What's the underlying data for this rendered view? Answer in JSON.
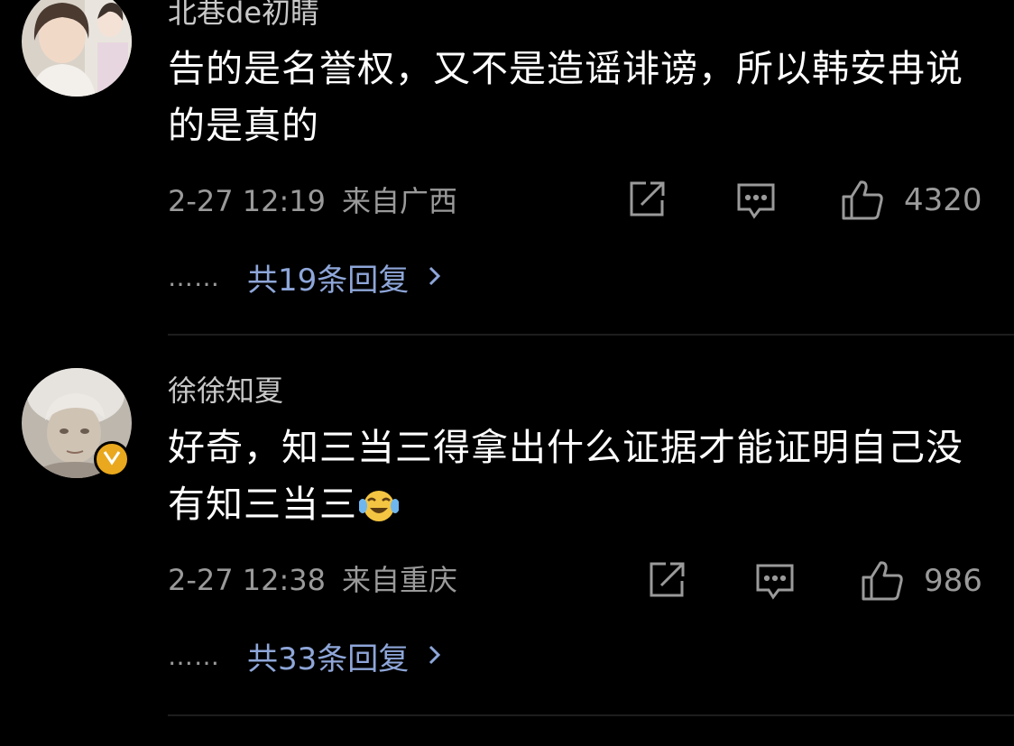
{
  "comments": [
    {
      "username": "北巷de初睛",
      "content": "告的是名誉权，又不是造谣诽谤，所以韩安冉说的是真的",
      "time": "2-27 12:19",
      "location": "来自广西",
      "likes": "4320",
      "replies": "共19条回复",
      "dots": "……",
      "verified": false
    },
    {
      "username": "徐徐知夏",
      "content": "好奇，知三当三得拿出什么证据才能证明自己没有知三当三",
      "time": "2-27 12:38",
      "location": "来自重庆",
      "likes": "986",
      "replies": "共33条回复",
      "dots": "……",
      "verified": true,
      "emoji": "laugh-cry-emoji"
    }
  ],
  "icons": {
    "share": "share-icon",
    "comment": "comment-icon",
    "like": "thumbs-up-icon",
    "chevron": "chevron-right-icon",
    "verified": "verified-v-icon"
  },
  "colors": {
    "background": "#000000",
    "text": "#ffffff",
    "muted": "#9a9a9a",
    "link": "#8ea6d9",
    "badge": "#e9a81d"
  }
}
